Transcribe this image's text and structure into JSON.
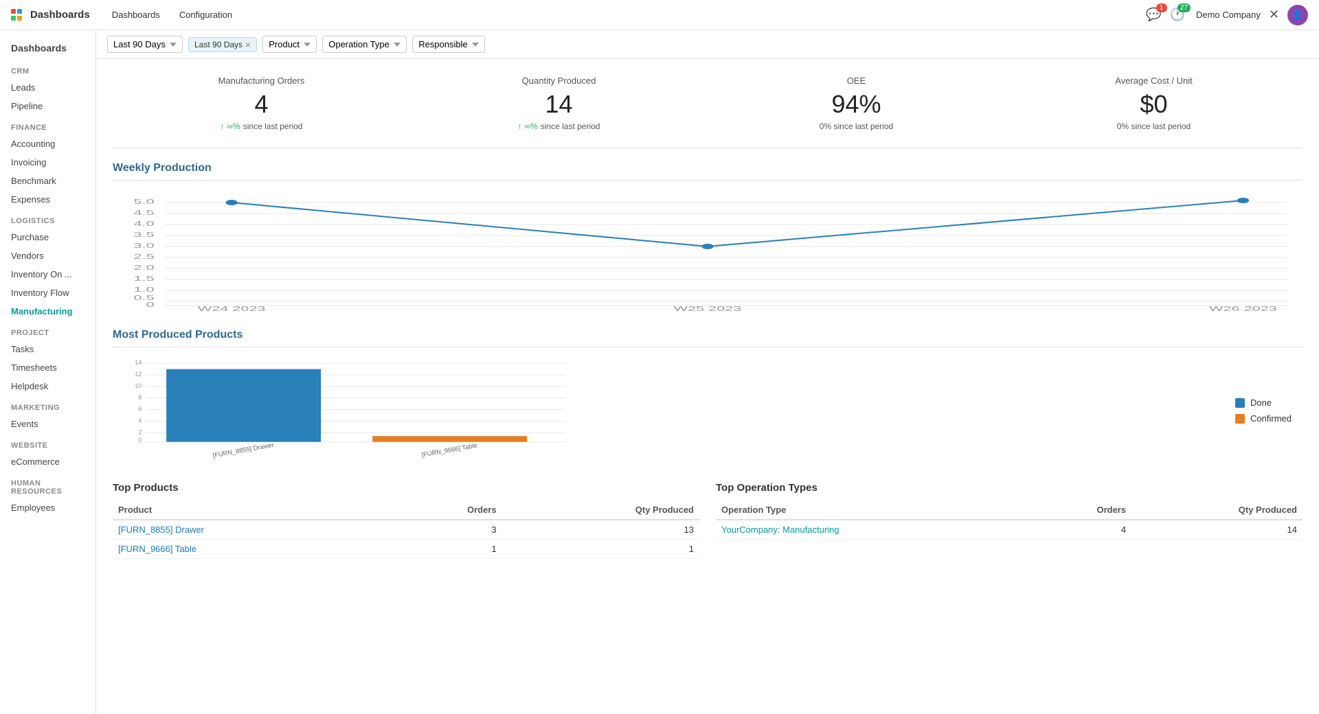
{
  "app": {
    "grid_icon_label": "App grid",
    "title": "Dashboards",
    "nav_links": [
      "Dashboards",
      "Configuration"
    ],
    "company": "Demo Company"
  },
  "notifications": {
    "chat_count": "1",
    "activity_count": "27"
  },
  "sidebar": {
    "dashboards_label": "Dashboards",
    "sections": [
      {
        "title": "CRM",
        "items": [
          {
            "label": "Leads",
            "active": false
          },
          {
            "label": "Pipeline",
            "active": false
          }
        ]
      },
      {
        "title": "FINANCE",
        "items": [
          {
            "label": "Accounting",
            "active": false
          },
          {
            "label": "Invoicing",
            "active": false
          },
          {
            "label": "Benchmark",
            "active": false
          },
          {
            "label": "Expenses",
            "active": false
          }
        ]
      },
      {
        "title": "LOGISTICS",
        "items": [
          {
            "label": "Purchase",
            "active": false
          },
          {
            "label": "Vendors",
            "active": false
          },
          {
            "label": "Inventory On ...",
            "active": false
          },
          {
            "label": "Inventory Flow",
            "active": false
          },
          {
            "label": "Manufacturing",
            "active": true
          }
        ]
      },
      {
        "title": "PROJECT",
        "items": [
          {
            "label": "Tasks",
            "active": false
          },
          {
            "label": "Timesheets",
            "active": false
          },
          {
            "label": "Helpdesk",
            "active": false
          }
        ]
      },
      {
        "title": "MARKETING",
        "items": [
          {
            "label": "Events",
            "active": false
          }
        ]
      },
      {
        "title": "WEBSITE",
        "items": [
          {
            "label": "eCommerce",
            "active": false
          }
        ]
      },
      {
        "title": "HUMAN RESOURCES",
        "items": [
          {
            "label": "Employees",
            "active": false
          }
        ]
      }
    ]
  },
  "filters": {
    "date_range": "Last 90 Days",
    "product_placeholder": "Product",
    "operation_type_placeholder": "Operation Type",
    "responsible_placeholder": "Responsible"
  },
  "kpis": [
    {
      "label": "Manufacturing Orders",
      "value": "4",
      "trend": "↑ ∞% since last period"
    },
    {
      "label": "Quantity Produced",
      "value": "14",
      "trend": "↑ ∞% since last period"
    },
    {
      "label": "OEE",
      "value": "94%",
      "trend": "0% since last period"
    },
    {
      "label": "Average Cost / Unit",
      "value": "$0",
      "trend": "0% since last period"
    }
  ],
  "weekly_production": {
    "title": "Weekly Production",
    "x_labels": [
      "W24 2023",
      "W25 2023",
      "W26 2023"
    ],
    "y_labels": [
      "0",
      "0.5",
      "1.0",
      "1.5",
      "2.0",
      "2.5",
      "3.0",
      "3.5",
      "4.0",
      "4.5",
      "5.0"
    ],
    "data_points": [
      5.0,
      3.0,
      5.2
    ]
  },
  "most_produced": {
    "title": "Most Produced Products",
    "legend": [
      {
        "label": "Done",
        "color": "#2980b9"
      },
      {
        "label": "Confirmed",
        "color": "#e67e22"
      }
    ],
    "bars": [
      {
        "label": "[FURN_8855] Drawer",
        "done": 13,
        "confirmed": 0
      },
      {
        "label": "[FURN_9666] Table",
        "done": 0,
        "confirmed": 1
      }
    ],
    "y_max": 14
  },
  "top_products": {
    "title": "Top Products",
    "columns": [
      "Product",
      "Orders",
      "Qty Produced"
    ],
    "rows": [
      {
        "product": "[FURN_8855] Drawer",
        "orders": "3",
        "qty": "13"
      },
      {
        "product": "[FURN_9666] Table",
        "orders": "1",
        "qty": "1"
      }
    ]
  },
  "top_operation_types": {
    "title": "Top Operation Types",
    "columns": [
      "Operation Type",
      "Orders",
      "Qty Produced"
    ],
    "rows": [
      {
        "operation": "YourCompany: Manufacturing",
        "orders": "4",
        "qty": "14"
      }
    ]
  }
}
